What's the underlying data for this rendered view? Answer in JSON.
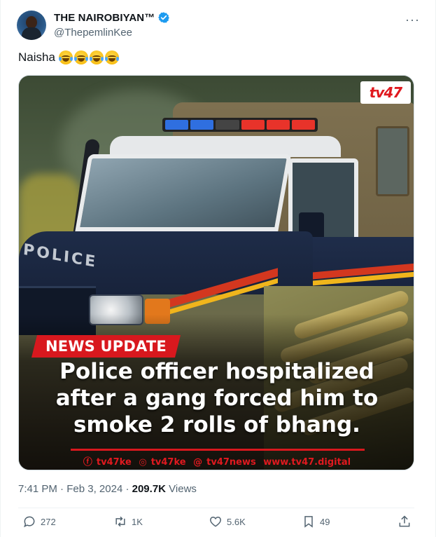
{
  "author": {
    "display_name": "THE NAIROBIYAN™",
    "handle": "@ThepemlinKee",
    "verified": true
  },
  "tweet": {
    "text": "Naisha",
    "emoji_icons": [
      "face-with-tears-of-joy-icon",
      "face-with-tears-of-joy-icon",
      "face-with-tears-of-joy-icon",
      "face-with-tears-of-joy-icon"
    ]
  },
  "media": {
    "brand_logo": "tv47",
    "badge": "NEWS UPDATE",
    "headline_lines": [
      "Police officer hospitalized",
      "after a gang forced him to",
      "smoke 2 rolls of bhang."
    ],
    "vehicle_text": "POLICE",
    "socials": {
      "facebook": "tv47ke",
      "instagram": "tv47ke",
      "threads": "tv47news",
      "website": "www.tv47.digital"
    },
    "colors": {
      "brand_red": "#d8181e",
      "police_blue": "#1e2c48",
      "stripe_yellow": "#f0b51c"
    },
    "lightbar_colors": [
      "#2f6fe0",
      "#2f6fe0",
      "#444444",
      "#e8332a",
      "#e8332a",
      "#e8332a"
    ]
  },
  "meta": {
    "time": "7:41 PM",
    "separator": "·",
    "date": "Feb 3, 2024",
    "views_count": "209.7K",
    "views_label": "Views"
  },
  "actions": {
    "replies": "272",
    "retweets": "1K",
    "likes": "5.6K",
    "bookmarks": "49"
  },
  "colors": {
    "text_primary": "#0f1419",
    "text_secondary": "#536471",
    "verified_blue": "#1d9bf0",
    "border": "#eff3f4"
  }
}
